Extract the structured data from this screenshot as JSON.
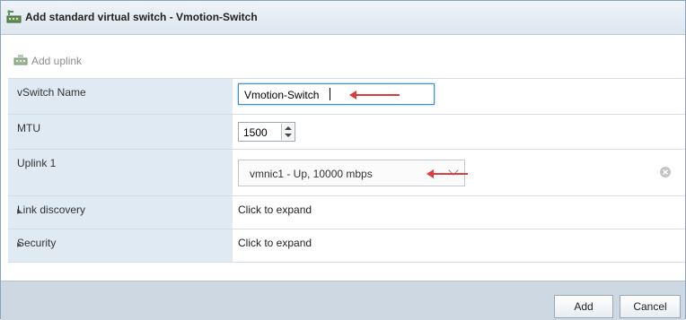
{
  "dialog": {
    "title": "Add standard virtual switch - Vmotion-Switch"
  },
  "toolbar": {
    "add_uplink_label": "Add uplink"
  },
  "form": {
    "vswitch_name": {
      "label": "vSwitch Name",
      "value": "Vmotion-Switch"
    },
    "mtu": {
      "label": "MTU",
      "value": "1500"
    },
    "uplink1": {
      "label": "Uplink 1",
      "selected": "vmnic1 - Up, 10000 mbps"
    },
    "link_discovery": {
      "label": "Link discovery",
      "value": "Click to expand"
    },
    "security": {
      "label": "Security",
      "value": "Click to expand"
    }
  },
  "footer": {
    "add_label": "Add",
    "cancel_label": "Cancel"
  },
  "colors": {
    "label_bg": "#dfeaf3",
    "annotation_arrow": "#e03a3a",
    "footer_bg": "#cdd8e3",
    "focus_border": "#3f8fd2"
  },
  "icons": [
    "vswitch-icon",
    "add-uplink-icon",
    "spinner-icon",
    "chevron-down-icon",
    "clear-icon",
    "expand-arrow-icon",
    "annotation-arrow"
  ]
}
